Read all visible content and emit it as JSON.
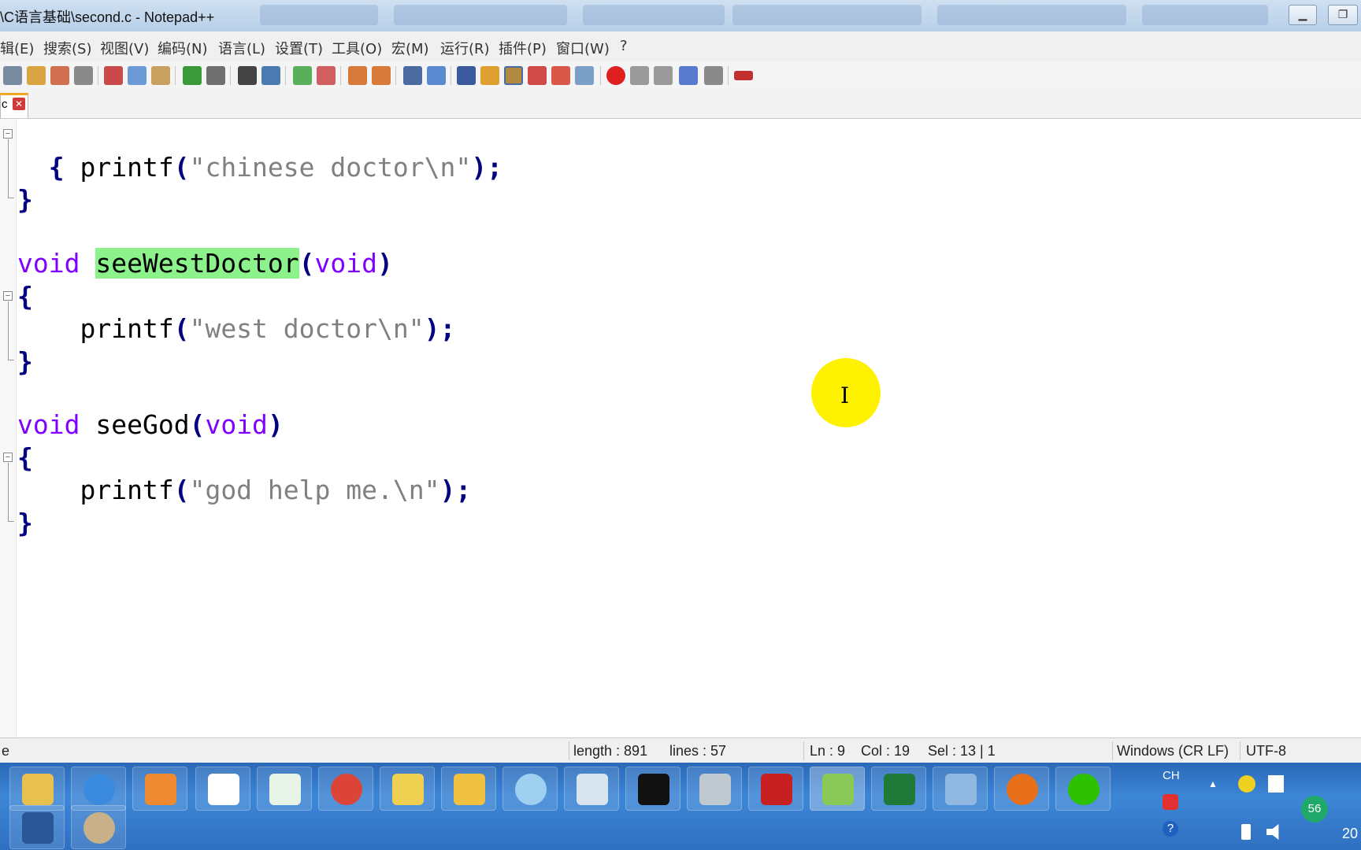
{
  "window": {
    "title": "\\C语言基础\\second.c - Notepad++",
    "minimize_glyph": "▁",
    "maximize_glyph": "❐"
  },
  "menu": [
    "辑(E)",
    "搜索(S)",
    "视图(V)",
    "编码(N)",
    "语言(L)",
    "设置(T)",
    "工具(O)",
    "宏(M)",
    "运行(R)",
    "插件(P)",
    "窗口(W)",
    "?"
  ],
  "tab": {
    "label": "c",
    "close_glyph": "✕"
  },
  "code": {
    "l1_brace": "{",
    "l2_fn": "printf",
    "l2_open": "(",
    "l2_str": "\"chinese doctor\\n\"",
    "l2_close": ");",
    "l3_brace": "}",
    "l5_kw": "void",
    "l5_name": "seeWestDoctor",
    "l5_open": "(",
    "l5_kw2": "void",
    "l5_close": ")",
    "l6_brace": "{",
    "l7_fn": "printf",
    "l7_open": "(",
    "l7_str": "\"west doctor\\n\"",
    "l7_close": ");",
    "l8_brace": "}",
    "l10_kw": "void",
    "l10_name": "seeGod",
    "l10_open": "(",
    "l10_kw2": "void",
    "l10_close": ")",
    "l11_brace": "{",
    "l12_fn": "printf",
    "l12_open": "(",
    "l12_str": "\"god help me.\\n\"",
    "l12_close": ");",
    "l13_brace": "}"
  },
  "status": {
    "left": "e",
    "length": "length : 891",
    "lines": "lines : 57",
    "ln": "Ln : 9",
    "col": "Col : 19",
    "sel": "Sel : 13 | 1",
    "eol": "Windows (CR LF)",
    "encoding": "UTF-8"
  },
  "tray": {
    "ime": "CH",
    "badge": "56",
    "clock": "20",
    "help": "?"
  },
  "colors": {
    "keyword": "#8000ff",
    "operator": "#000080",
    "string": "#808080",
    "highlight": "#8cf28c",
    "taskbar": "#2f6fc0"
  }
}
